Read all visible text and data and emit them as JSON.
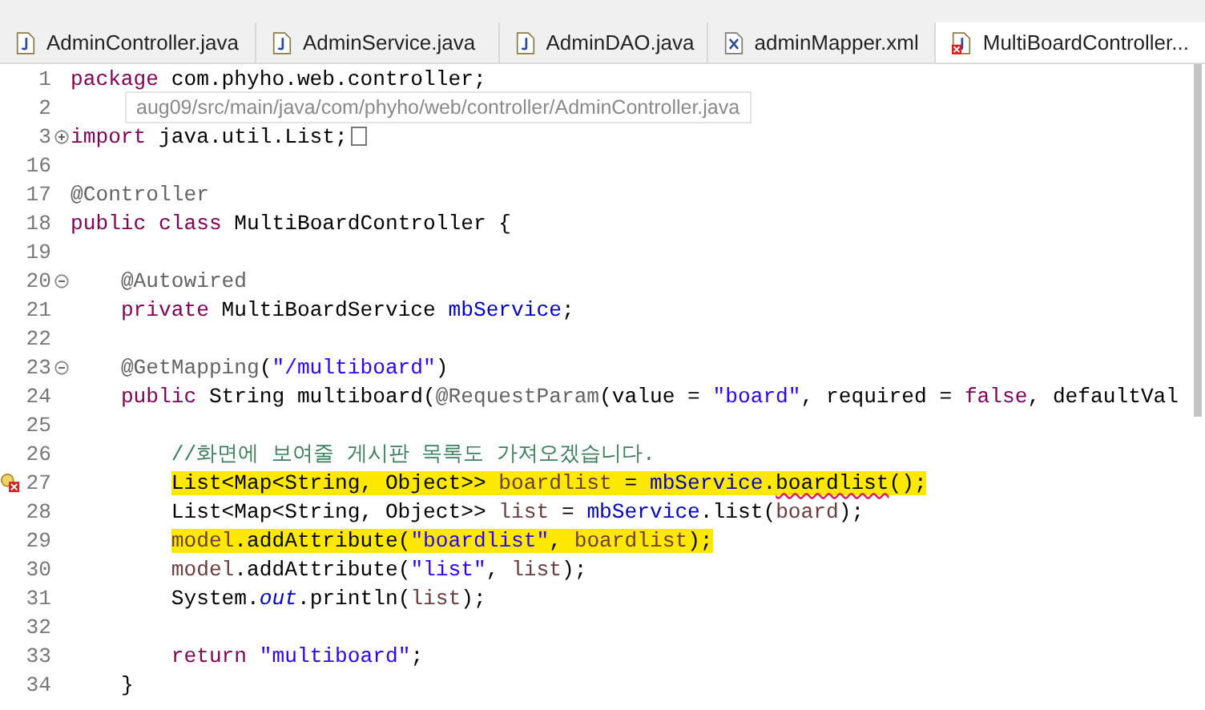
{
  "tabs": [
    {
      "label": "AdminController.java",
      "selected": false,
      "kind": "java"
    },
    {
      "label": "AdminService.java",
      "selected": false,
      "kind": "java"
    },
    {
      "label": "AdminDAO.java",
      "selected": false,
      "kind": "java"
    },
    {
      "label": "adminMapper.xml",
      "selected": false,
      "kind": "xml"
    },
    {
      "label": "MultiBoardController...",
      "selected": true,
      "kind": "java-error"
    }
  ],
  "tooltip": "aug09/src/main/java/com/phyho/web/controller/AdminController.java",
  "lines": [
    {
      "number": "1",
      "highlighted": false,
      "tokens": [
        {
          "text": "package",
          "kind": "keyword"
        },
        {
          "text": " com.phyho.web.controller;",
          "kind": "plain"
        }
      ]
    },
    {
      "number": "2"
    },
    {
      "number": "3",
      "folded": true,
      "folded_tail": true,
      "highlighted": false,
      "tokens": [
        {
          "text": "import",
          "kind": "keyword"
        },
        {
          "text": " java.util.List;",
          "kind": "plain"
        }
      ]
    },
    {
      "number": "16"
    },
    {
      "number": "17",
      "highlighted": false,
      "tokens": [
        {
          "text": "@Controller",
          "kind": "annotation"
        }
      ]
    },
    {
      "number": "18",
      "highlighted": false,
      "tokens": [
        {
          "text": "public",
          "kind": "keyword"
        },
        {
          "text": " class",
          "kind": "keyword"
        },
        {
          "text": " MultiBoardController {",
          "kind": "plain"
        }
      ]
    },
    {
      "number": "19"
    },
    {
      "number": "20",
      "folded": false,
      "highlighted": false,
      "tokens": [
        {
          "text": "    @Autowired",
          "kind": "annotation"
        }
      ]
    },
    {
      "number": "21",
      "highlighted": false,
      "tokens": [
        {
          "text": "    private",
          "kind": "keyword"
        },
        {
          "text": " MultiBoardService ",
          "kind": "plain"
        },
        {
          "text": "mbService",
          "kind": "field"
        },
        {
          "text": ";",
          "kind": "plain"
        }
      ]
    },
    {
      "number": "22"
    },
    {
      "number": "23",
      "folded": false,
      "highlighted": false,
      "tokens": [
        {
          "text": "    @GetMapping",
          "kind": "annotation"
        },
        {
          "text": "(",
          "kind": "plain"
        },
        {
          "text": "\"/multiboard\"",
          "kind": "string"
        },
        {
          "text": ")",
          "kind": "plain"
        }
      ]
    },
    {
      "number": "24",
      "highlighted": false,
      "tokens": [
        {
          "text": "    public",
          "kind": "keyword"
        },
        {
          "text": " String multiboard(",
          "kind": "plain"
        },
        {
          "text": "@RequestParam",
          "kind": "annotation"
        },
        {
          "text": "(value = ",
          "kind": "plain"
        },
        {
          "text": "\"board\"",
          "kind": "string"
        },
        {
          "text": ", required = ",
          "kind": "plain"
        },
        {
          "text": "false",
          "kind": "keyword"
        },
        {
          "text": ", defaultVal",
          "kind": "plain"
        }
      ]
    },
    {
      "number": "25"
    },
    {
      "number": "26",
      "highlighted": false,
      "tokens": [
        {
          "text": "        //화면에 보여줄 게시판 목록도 가져오겠습니다.",
          "kind": "comment"
        }
      ]
    },
    {
      "number": "27",
      "error": true,
      "highlighted": true,
      "tokens": [
        {
          "text": "        List<Map<String, Object>> ",
          "kind": "plain"
        },
        {
          "text": "boardlist",
          "kind": "local"
        },
        {
          "text": " = ",
          "kind": "plain"
        },
        {
          "text": "mbService",
          "kind": "field"
        },
        {
          "text": ".",
          "kind": "plain"
        },
        {
          "text": "boardlist",
          "kind": "plain",
          "squiggle": true
        },
        {
          "text": "();",
          "kind": "plain"
        }
      ]
    },
    {
      "number": "28",
      "highlighted": false,
      "tokens": [
        {
          "text": "        List<Map<String, Object>> ",
          "kind": "plain"
        },
        {
          "text": "list",
          "kind": "local"
        },
        {
          "text": " = ",
          "kind": "plain"
        },
        {
          "text": "mbService",
          "kind": "field"
        },
        {
          "text": ".list(",
          "kind": "plain"
        },
        {
          "text": "board",
          "kind": "local"
        },
        {
          "text": ");",
          "kind": "plain"
        }
      ]
    },
    {
      "number": "29",
      "highlighted": true,
      "tokens": [
        {
          "text": "        model",
          "kind": "local"
        },
        {
          "text": ".addAttribute(",
          "kind": "plain"
        },
        {
          "text": "\"boardlist\"",
          "kind": "string"
        },
        {
          "text": ", ",
          "kind": "plain"
        },
        {
          "text": "boardlist",
          "kind": "local"
        },
        {
          "text": ");",
          "kind": "plain"
        }
      ]
    },
    {
      "number": "30",
      "highlighted": false,
      "tokens": [
        {
          "text": "        model",
          "kind": "local"
        },
        {
          "text": ".addAttribute(",
          "kind": "plain"
        },
        {
          "text": "\"list\"",
          "kind": "string"
        },
        {
          "text": ", ",
          "kind": "plain"
        },
        {
          "text": "list",
          "kind": "local"
        },
        {
          "text": ");",
          "kind": "plain"
        }
      ]
    },
    {
      "number": "31",
      "highlighted": false,
      "tokens": [
        {
          "text": "        System.",
          "kind": "plain"
        },
        {
          "text": "out",
          "kind": "static"
        },
        {
          "text": ".println(",
          "kind": "plain"
        },
        {
          "text": "list",
          "kind": "local"
        },
        {
          "text": ");",
          "kind": "plain"
        }
      ]
    },
    {
      "number": "32"
    },
    {
      "number": "33",
      "highlighted": false,
      "tokens": [
        {
          "text": "        return",
          "kind": "keyword"
        },
        {
          "text": " \"multiboard\"",
          "kind": "string"
        },
        {
          "text": ";",
          "kind": "plain"
        }
      ]
    },
    {
      "number": "34",
      "highlighted": false,
      "tokens": [
        {
          "text": "    }",
          "kind": "plain"
        }
      ]
    }
  ]
}
